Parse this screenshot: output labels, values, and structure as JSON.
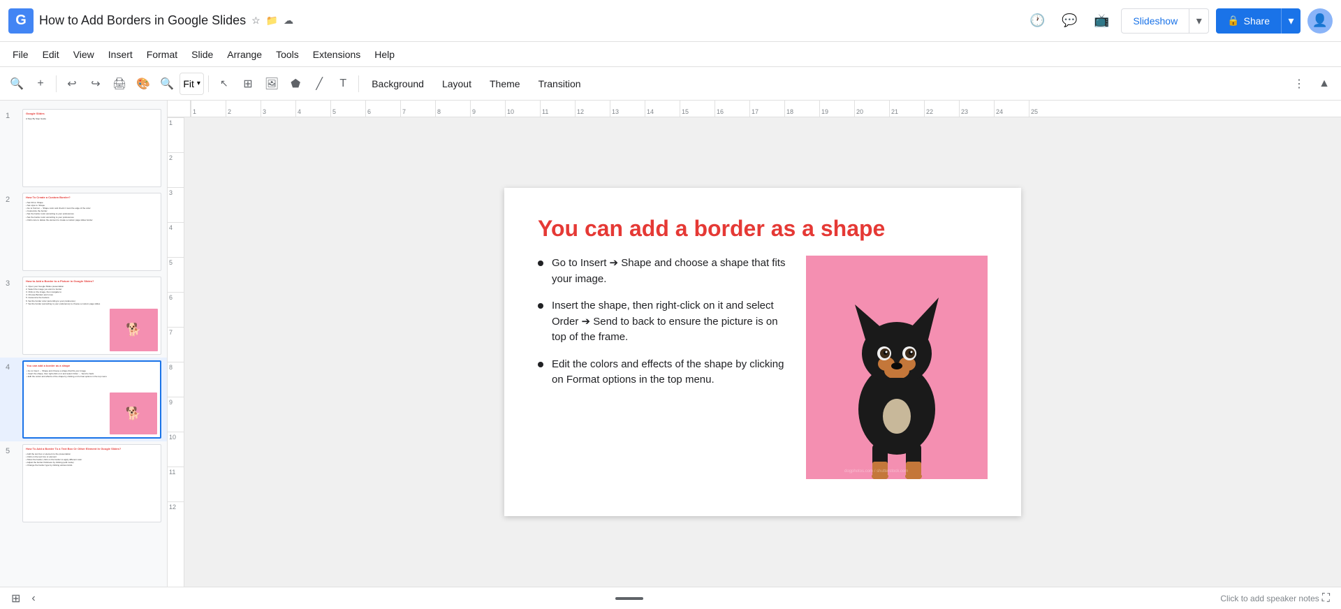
{
  "app": {
    "logo": "G",
    "title": "How to Add Borders in Google Slides",
    "star_icon": "⭐",
    "folder_icon": "📁",
    "cloud_icon": "☁"
  },
  "header": {
    "slideshow_label": "Slideshow",
    "share_label": "Share",
    "lock_icon": "🔒"
  },
  "menu": {
    "items": [
      "File",
      "Edit",
      "View",
      "Insert",
      "Format",
      "Slide",
      "Arrange",
      "Tools",
      "Extensions",
      "Help"
    ]
  },
  "toolbar": {
    "zoom_label": "Fit",
    "bg_label": "Background",
    "layout_label": "Layout",
    "theme_label": "Theme",
    "transition_label": "Transition"
  },
  "ruler": {
    "marks": [
      "1",
      "2",
      "3",
      "4",
      "5",
      "6",
      "7",
      "8",
      "9",
      "10",
      "11",
      "12",
      "13",
      "14",
      "15",
      "16",
      "17",
      "18",
      "19",
      "20",
      "21",
      "22",
      "23",
      "24",
      "25"
    ],
    "v_marks": [
      "1",
      "2",
      "3",
      "4",
      "5",
      "6",
      "7",
      "8",
      "9",
      "10",
      "11",
      "12"
    ]
  },
  "slides": [
    {
      "num": "1",
      "title": "Google Slides",
      "subtitle": "A Step By Step Guide",
      "active": false,
      "has_image": false
    },
    {
      "num": "2",
      "title": "How To Create a Custom Border?",
      "active": false,
      "has_image": false
    },
    {
      "num": "3",
      "title": "How to Add a Border to a Picture in Google Slides?",
      "active": false,
      "has_image": true
    },
    {
      "num": "4",
      "title": "You can add a border as a shape",
      "active": true,
      "has_image": true
    },
    {
      "num": "5",
      "title": "How To Add a Border To a Text Box Or Other Element In Google Slides?",
      "active": false,
      "has_image": false
    }
  ],
  "slide": {
    "heading": "You can add a border as a shape",
    "bullets": [
      "Go to Insert → Shape and choose a shape that fits your image.",
      "Insert the shape, then right-click on it and select Order → Send to back to ensure the picture is on top of the frame.",
      "Edit the colors and effects of the shape by clicking on Format options in the top menu."
    ],
    "image_alt": "Dog photo on pink background"
  },
  "bottom": {
    "slide_hint": "Click to add speaker notes",
    "expand_icon": "⛶"
  }
}
